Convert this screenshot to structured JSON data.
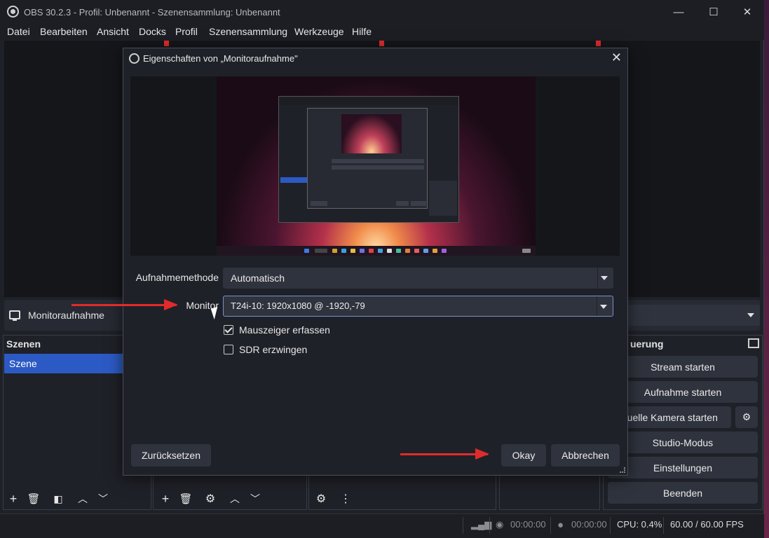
{
  "window": {
    "title": "OBS 30.2.3 - Profil: Unbenannt - Szenensammlung: Unbenannt",
    "controls": {
      "minimize": "—",
      "maximize": "☐",
      "close": "✕"
    }
  },
  "menu": [
    "Datei",
    "Bearbeiten",
    "Ansicht",
    "Docks",
    "Profil",
    "Szenensammlung",
    "Werkzeuge",
    "Hilfe"
  ],
  "source_bar": {
    "label": "Monitoraufnahme"
  },
  "scenes": {
    "title": "Szenen",
    "items": [
      "Szene"
    ]
  },
  "controls_dock": {
    "title": "uerung",
    "buttons": [
      "Stream starten",
      "Aufnahme starten",
      "rtuelle Kamera starten",
      "Studio-Modus",
      "Einstellungen",
      "Beenden"
    ]
  },
  "status": {
    "rec1": "00:00:00",
    "rec2": "00:00:00",
    "cpu": "CPU: 0.4%",
    "fps": "60.00 / 60.00 FPS"
  },
  "dialog": {
    "title": "Eigenschaften von „Monitoraufnahme\"",
    "capture_method": {
      "label": "Aufnahmemethode",
      "value": "Automatisch"
    },
    "monitor": {
      "label": "Monitor",
      "value": "T24i-10: 1920x1080 @ -1920,-79"
    },
    "checkboxes": [
      {
        "label": "Mauszeiger erfassen",
        "checked": true
      },
      {
        "label": "SDR erzwingen",
        "checked": false
      }
    ],
    "buttons": {
      "reset": "Zurücksetzen",
      "ok": "Okay",
      "cancel": "Abbrechen"
    }
  },
  "colors": {
    "accent": "#2c5ac4",
    "arrow": "#e12b2b",
    "background": "#1f2128"
  }
}
